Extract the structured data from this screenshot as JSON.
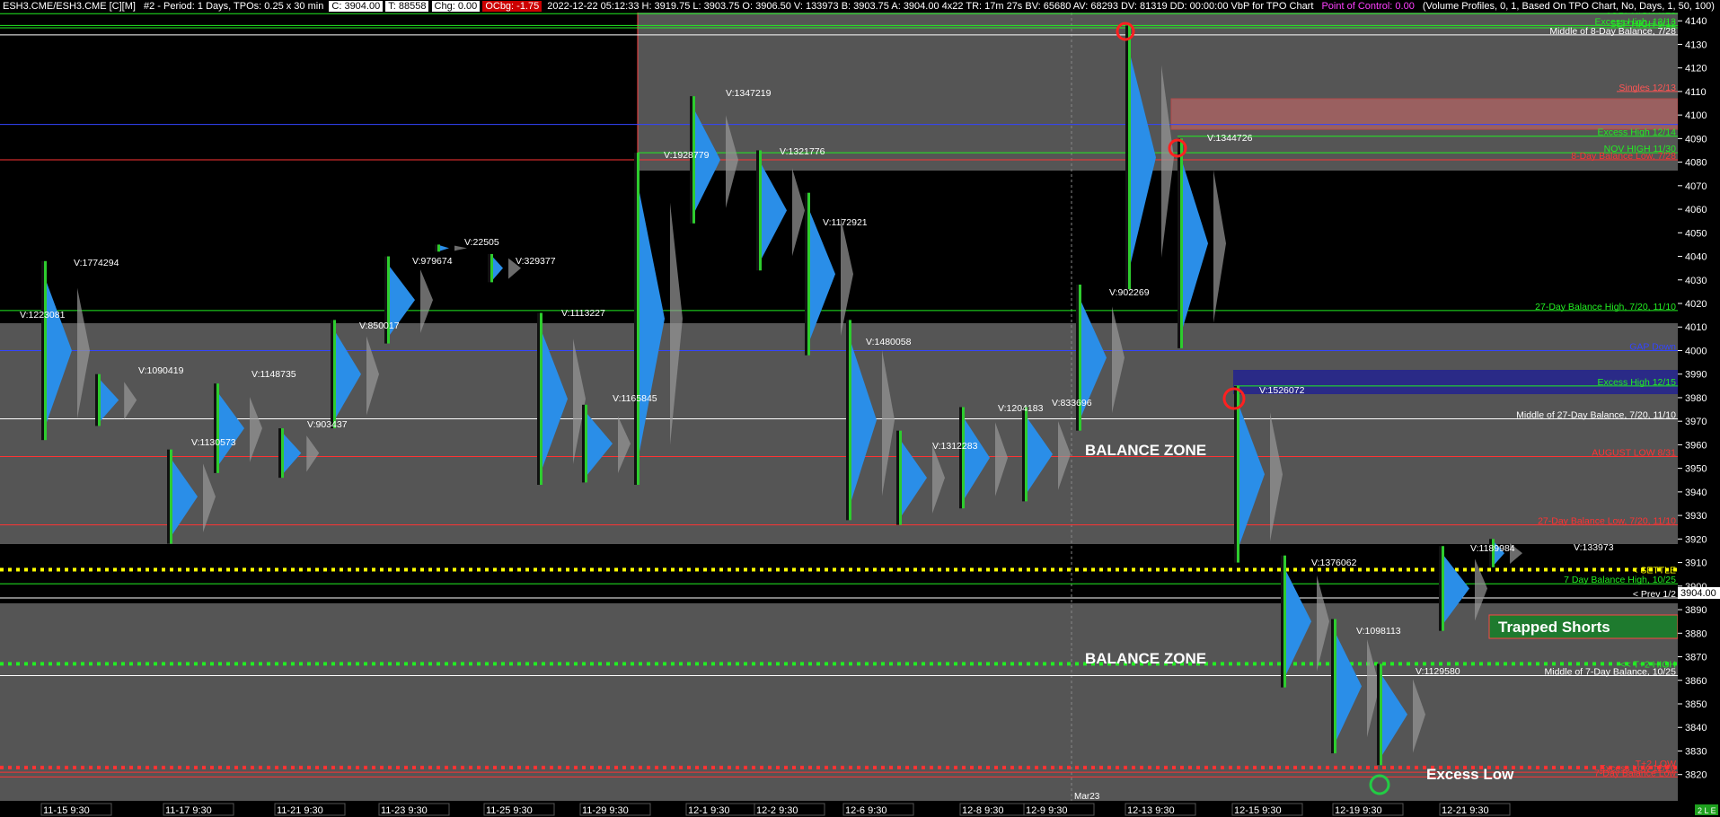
{
  "header": {
    "symbol": "ESH3.CME/ESH3.CME [C][M]",
    "period": "#2 - Period: 1 Days, TPOs: 0.25 x 30 min",
    "close": "C: 3904.00",
    "ticks": "T: 88558",
    "chg": "Chg: 0.00",
    "ocbg": "OCbg: -1.75",
    "stats": "2022-12-22 05:12:33 H: 3919.75 L: 3903.75 O: 3906.50 V: 133973 B: 3903.75 A: 3904.00 4x22 TR: 17m 27s BV: 65680 AV: 68293 DV: 81319 DD: 00:00:00 VbP for TPO Chart",
    "poc": "Point of Control: 0.00",
    "profiles": "(Volume Profiles, 0, 1, Based On TPO Chart, No, Days, 1, 50, 100)"
  },
  "chart_data": {
    "type": "line",
    "title": "",
    "ylim": [
      3815,
      4150
    ],
    "y_ticks": [
      3820,
      3830,
      3840,
      3850,
      3860,
      3870,
      3880,
      3890,
      3900,
      3910,
      3920,
      3930,
      3940,
      3950,
      3960,
      3970,
      3980,
      3990,
      4000,
      4010,
      4020,
      4030,
      4040,
      4050,
      4060,
      4070,
      4080,
      4090,
      4100,
      4110,
      4120,
      4130,
      4140
    ],
    "x_labels": [
      "11-15  9:30",
      "11-17  9:30",
      "11-21  9:30",
      "11-23  9:30",
      "11-25  9:30",
      "11-29  9:30",
      "12-1  9:30",
      "12-2  9:30",
      "12-6  9:30",
      "12-8  9:30",
      "12-9  9:30",
      "12-13  9:30",
      "12-15  9:30",
      "12-19  9:30",
      "12-21  9:30"
    ],
    "current_price": "3904.00",
    "reference_lines": [
      {
        "price": 4143,
        "label": "JULY HIGH 7/28",
        "color": "#22ee22"
      },
      {
        "price": 4138,
        "label": "Excess High, 12/13",
        "color": "#22ee22"
      },
      {
        "price": 4137,
        "label": "SEP HIGH 9/12",
        "color": "#22ee22"
      },
      {
        "price": 4134,
        "label": "Middle of 8-Day Balance, 7/28",
        "color": "#ffffff"
      },
      {
        "price": 4110,
        "label": "Singles 12/13",
        "color": "#ff5555"
      },
      {
        "price": 4096,
        "label": "",
        "color": "#3344ff"
      },
      {
        "price": 4091,
        "label": "Excess High 12/14",
        "color": "#22ee22"
      },
      {
        "price": 4084,
        "label": "NOV HIGH 11/30",
        "color": "#22ee22"
      },
      {
        "price": 4081,
        "label": "8-Day Balance Low, 7/28",
        "color": "#ff3333"
      },
      {
        "price": 4017,
        "label": "27-Day Balance High, 7/20, 11/10",
        "color": "#22ee22"
      },
      {
        "price": 4000,
        "label": "GAP Down",
        "color": "#3344ff"
      },
      {
        "price": 3985,
        "label": "Excess High 12/15",
        "color": "#22ee22"
      },
      {
        "price": 3971,
        "label": "Middle of 27-Day Balance, 7/20, 11/10",
        "color": "#ffffff"
      },
      {
        "price": 3955,
        "label": "AUGUST LOW 8/31",
        "color": "#ff3333"
      },
      {
        "price": 3926,
        "label": "27-Day Balance Low, 7/20, 11/10",
        "color": "#ff3333"
      },
      {
        "price": 3907,
        "label": "< SETTLE",
        "color": "#ffff00"
      },
      {
        "price": 3901,
        "label": "7 Day Balance High, 10/25",
        "color": "#22ee22"
      },
      {
        "price": 3895,
        "label": "< Prev 1/2",
        "color": "#ffffff"
      },
      {
        "price": 3867,
        "label": "<< T+2 HIGH",
        "color": "#22ee22"
      },
      {
        "price": 3862,
        "label": "Middle of 7-Day Balance, 10/25",
        "color": "#ffffff"
      },
      {
        "price": 3823,
        "label": "T+2 LOW",
        "color": "#ff3333"
      },
      {
        "price": 3821,
        "label": "Excess Low 12/20",
        "color": "#ff3333"
      },
      {
        "price": 3819,
        "label": "7-Day Balance Low",
        "color": "#ff3333"
      }
    ],
    "volume_labels": [
      "V:1223081",
      "V:1774294",
      "V:1090419",
      "V:1130573",
      "V:1148735",
      "V:903437",
      "V:850017",
      "V:979674",
      "V:22505",
      "V:329377",
      "V:1113227",
      "V:1165845",
      "V:1928779",
      "V:1347219",
      "V:1321776",
      "V:1172921",
      "V:1480058",
      "V:1312283",
      "V:1204183",
      "V:833696",
      "V:902269",
      "V:1344726",
      "V:1526072",
      "V:1376062",
      "V:1098113",
      "V:1129580",
      "V:1189984",
      "V:133973"
    ],
    "annotations": {
      "balance_zone_upper": "BALANCE ZONE",
      "balance_zone_lower": "BALANCE ZONE",
      "trapped_shorts": "Trapped Shorts",
      "excess_low": "Excess Low",
      "contract_marker": "Mar23",
      "corner_tag": "2 L E"
    }
  }
}
